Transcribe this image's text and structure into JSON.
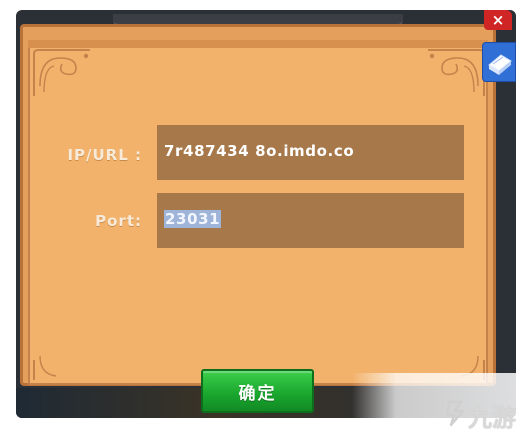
{
  "dialog": {
    "ip_label": "IP/URL :",
    "ip_value": "7r487434 8o.imdo.co",
    "port_label": "Port:",
    "port_value": "23031",
    "confirm_label": "确定"
  },
  "window": {
    "close_label": "×"
  },
  "watermark": {
    "text": "九游"
  },
  "colors": {
    "panel": "#f2b26c",
    "field": "#a7784a",
    "confirm": "#19a52d",
    "close": "#d02525",
    "book": "#2f6fd6"
  },
  "icons": {
    "close": "close-icon",
    "book": "book-icon",
    "watermark": "jiuyou-logo-icon"
  }
}
